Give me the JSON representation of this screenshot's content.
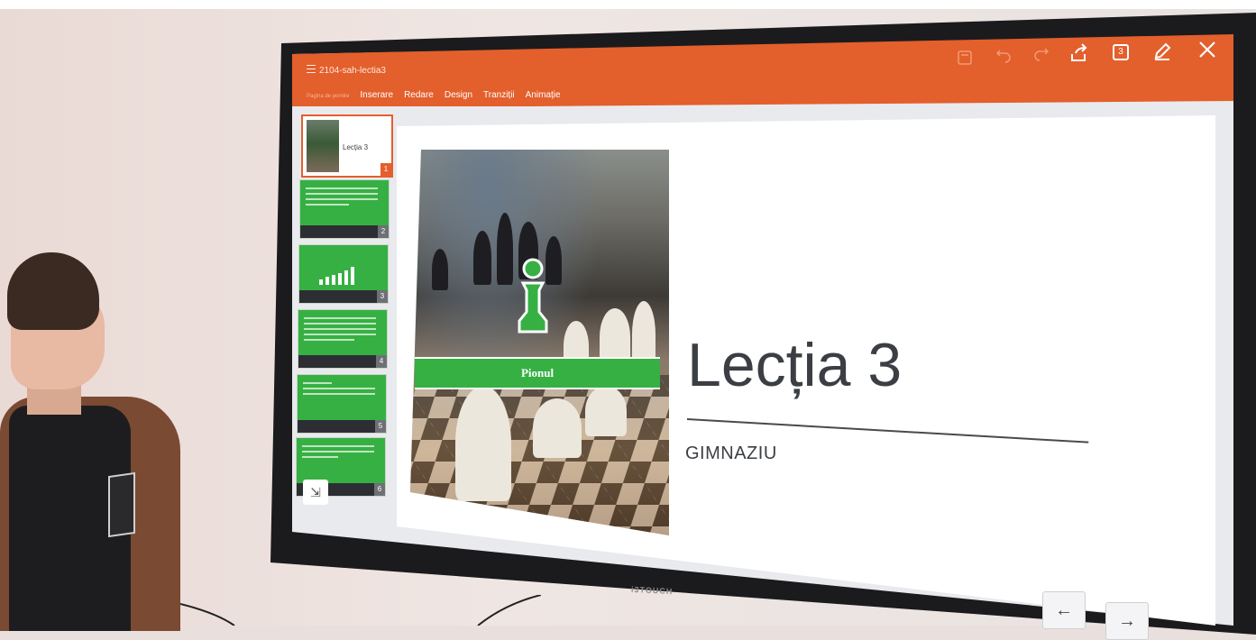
{
  "app": {
    "document_title": "2104-sah-lectia3",
    "tabs": [
      {
        "label": "Pagina de pornire",
        "active": true
      },
      {
        "label": "Inserare",
        "active": false
      },
      {
        "label": "Redare",
        "active": false
      },
      {
        "label": "Design",
        "active": false
      },
      {
        "label": "Tranziții",
        "active": false
      },
      {
        "label": "Animație",
        "active": false
      }
    ],
    "toolbar_icons": [
      "save-icon",
      "undo-icon",
      "redo-icon",
      "share-icon",
      "slide-number-icon",
      "edit-icon",
      "close-icon"
    ],
    "toolbar_slide_number": "3",
    "accent_color": "#e35f2c",
    "slide_green": "#36b043"
  },
  "thumbnails": [
    {
      "number": "1",
      "label": "Lecția 3"
    },
    {
      "number": "2"
    },
    {
      "number": "3"
    },
    {
      "number": "4"
    },
    {
      "number": "5"
    },
    {
      "number": "6"
    }
  ],
  "slide": {
    "image_caption": "Pionul",
    "title": "Lecția 3",
    "subtitle": "GIMNAZIU"
  },
  "monitor": {
    "brand": "i3TOUCH"
  },
  "navigation": {
    "prev": "←",
    "next": "→"
  }
}
